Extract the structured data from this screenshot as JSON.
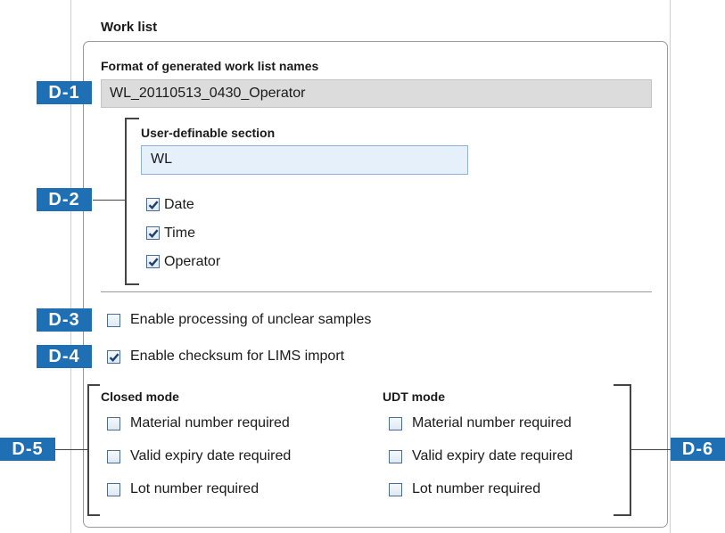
{
  "work_list": {
    "title": "Work list",
    "format_label": "Format of generated work list names",
    "format_value": "WL_20110513_0430_Operator",
    "user_section_label": "User-definable section",
    "user_section_value": "WL",
    "date_label": "Date",
    "time_label": "Time",
    "operator_label": "Operator",
    "unclear_label": "Enable processing of unclear samples",
    "checksum_label": "Enable checksum for LIMS import",
    "closed_mode": {
      "title": "Closed mode",
      "material_label": "Material number required",
      "expiry_label": "Valid expiry date required",
      "lot_label": "Lot number required"
    },
    "udt_mode": {
      "title": "UDT mode",
      "material_label": "Material number required",
      "expiry_label": "Valid expiry date required",
      "lot_label": "Lot number required"
    }
  },
  "callouts": {
    "d1": "D-1",
    "d2": "D-2",
    "d3": "D-3",
    "d4": "D-4",
    "d5": "D-5",
    "d6": "D-6"
  },
  "checkbox_states": {
    "date": true,
    "time": true,
    "operator": true,
    "unclear": false,
    "checksum": true,
    "closed_material": false,
    "closed_expiry": false,
    "closed_lot": false,
    "udt_material": false,
    "udt_expiry": false,
    "udt_lot": false
  },
  "colors": {
    "callout": "#1f6fb5",
    "edit_field": "#e6f0fb",
    "readonly_field": "#dcdcdc",
    "check": "#1d3f74"
  }
}
